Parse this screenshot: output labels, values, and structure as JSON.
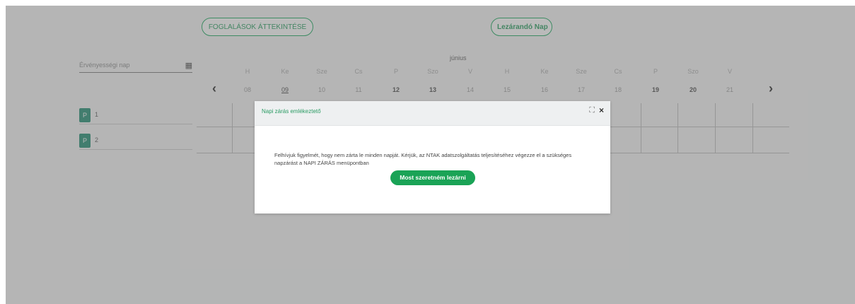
{
  "header": {
    "overview_button": "FOGLALÁSOK ÁTTEKINTÉSE",
    "close_day_button": "Lezárandó Nap"
  },
  "filter": {
    "date_label": "Érvényességi nap"
  },
  "calendar": {
    "month": "június",
    "days": [
      {
        "name": "H",
        "date": "08"
      },
      {
        "name": "Ke",
        "date": "09"
      },
      {
        "name": "Sze",
        "date": "10"
      },
      {
        "name": "Cs",
        "date": "11"
      },
      {
        "name": "P",
        "date": "12"
      },
      {
        "name": "Szo",
        "date": "13"
      },
      {
        "name": "V",
        "date": "14"
      },
      {
        "name": "H",
        "date": "15"
      },
      {
        "name": "Ke",
        "date": "16"
      },
      {
        "name": "Sze",
        "date": "17"
      },
      {
        "name": "Cs",
        "date": "18"
      },
      {
        "name": "P",
        "date": "19"
      },
      {
        "name": "Szo",
        "date": "20"
      },
      {
        "name": "V",
        "date": "21"
      }
    ]
  },
  "rooms": [
    {
      "badge": "P",
      "number": "1"
    },
    {
      "badge": "P",
      "number": "2"
    }
  ],
  "modal": {
    "title": "Napi zárás emlékeztető",
    "expand_icon": "⛶",
    "close_icon": "×",
    "body": "Felhívjuk figyelmét, hogy nem zárta le minden napját. Kérjük, az NTAK adatszolgáltatás teljesítéséhez végezze el a szükséges napzárást a NAPI ZÁRÁS menüpontban",
    "button": "Most szeretném lezárni"
  },
  "nav": {
    "prev_icon": "‹",
    "next_icon": "›"
  }
}
